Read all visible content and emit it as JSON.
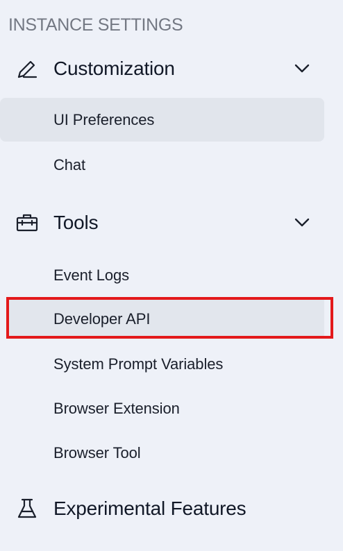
{
  "sidebar": {
    "section_title": "INSTANCE SETTINGS",
    "groups": [
      {
        "label": "Customization",
        "icon": "pencil-icon",
        "expanded": true,
        "items": [
          {
            "label": "UI Preferences",
            "selected": true
          },
          {
            "label": "Chat",
            "selected": false
          }
        ]
      },
      {
        "label": "Tools",
        "icon": "toolbox-icon",
        "expanded": true,
        "items": [
          {
            "label": "Event Logs",
            "selected": false
          },
          {
            "label": "Developer API",
            "highlighted": true
          },
          {
            "label": "System Prompt Variables",
            "selected": false
          },
          {
            "label": "Browser Extension",
            "selected": false
          },
          {
            "label": "Browser Tool",
            "selected": false
          }
        ]
      },
      {
        "label": "Experimental Features",
        "icon": "flask-icon"
      }
    ]
  },
  "colors": {
    "background": "#eef1f8",
    "selected_bg": "#e1e5ec",
    "annotation_red": "#e3191b",
    "section_title": "#737883"
  }
}
